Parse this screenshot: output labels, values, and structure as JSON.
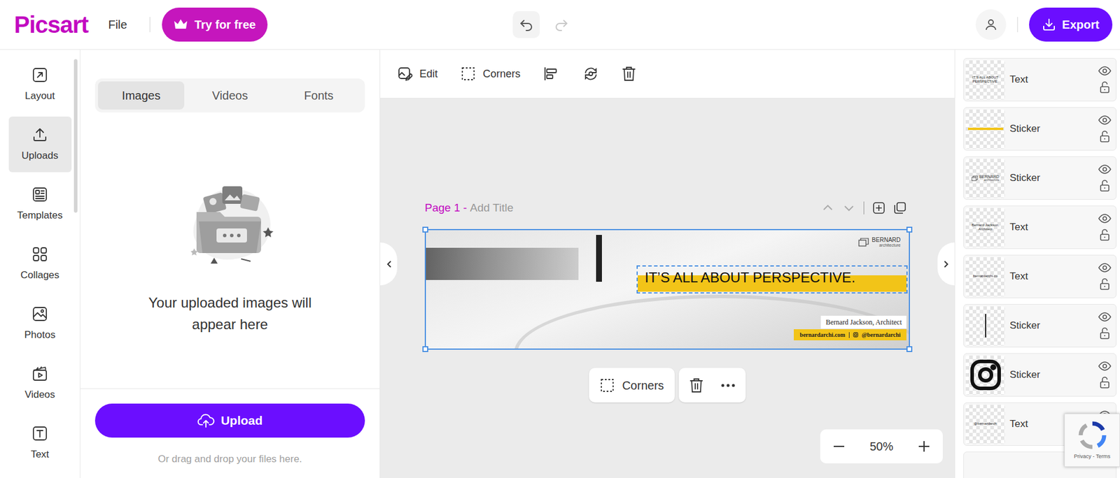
{
  "header": {
    "logo": "Picsart",
    "file": "File",
    "try_button": "Try for free",
    "export_button": "Export"
  },
  "history": {
    "undo": {
      "disabled": false
    },
    "redo": {
      "disabled": true
    }
  },
  "nav": [
    {
      "label": "Layout",
      "selected": false
    },
    {
      "label": "Uploads",
      "selected": true
    },
    {
      "label": "Templates",
      "selected": false
    },
    {
      "label": "Collages",
      "selected": false
    },
    {
      "label": "Photos",
      "selected": false
    },
    {
      "label": "Videos",
      "selected": false
    },
    {
      "label": "Text",
      "selected": false
    }
  ],
  "panel": {
    "tabs": [
      {
        "label": "Images",
        "selected": true
      },
      {
        "label": "Videos",
        "selected": false
      },
      {
        "label": "Fonts",
        "selected": false
      }
    ],
    "empty_message": "Your uploaded images will appear here",
    "upload_button": "Upload",
    "hint": "Or drag and drop your files here."
  },
  "toolbar": {
    "edit": "Edit",
    "corners": "Corners"
  },
  "page": {
    "label": "Page 1 - ",
    "title_placeholder": "Add Title"
  },
  "design": {
    "headline": "IT’S ALL ABOUT PERSPECTIVE.",
    "logo_name": "BERNARD",
    "logo_sub": "architecture",
    "name": "Bernard Jackson, Architect",
    "website": "bernardarchi.com",
    "social": "@bernardarchi"
  },
  "float_toolbar": {
    "corners": "Corners"
  },
  "zoom": {
    "level": "50%"
  },
  "layers": [
    {
      "label": "Text",
      "kind": "text",
      "thumb": "IT’S ALL ABOUT PERSPECTIVE.",
      "visible": true,
      "locked": false
    },
    {
      "label": "Sticker",
      "kind": "line",
      "thumb": "",
      "visible": true,
      "locked": false
    },
    {
      "label": "Sticker",
      "kind": "logo",
      "thumb": "BERNARD",
      "thumb_sub": "architecture",
      "visible": true,
      "locked": false
    },
    {
      "label": "Text",
      "kind": "text",
      "thumb": "Bernard Jackson, Architect",
      "visible": true,
      "locked": false
    },
    {
      "label": "Text",
      "kind": "text",
      "thumb": "bernardarchi.co",
      "visible": true,
      "locked": false
    },
    {
      "label": "Sticker",
      "kind": "divider",
      "thumb": "",
      "visible": true,
      "locked": false
    },
    {
      "label": "Sticker",
      "kind": "icon",
      "thumb": "",
      "visible": true,
      "locked": false
    },
    {
      "label": "Text",
      "kind": "text",
      "thumb": "@bernardarch",
      "visible": true,
      "locked": false
    }
  ],
  "recaptcha": {
    "links": "Privacy - Terms"
  }
}
